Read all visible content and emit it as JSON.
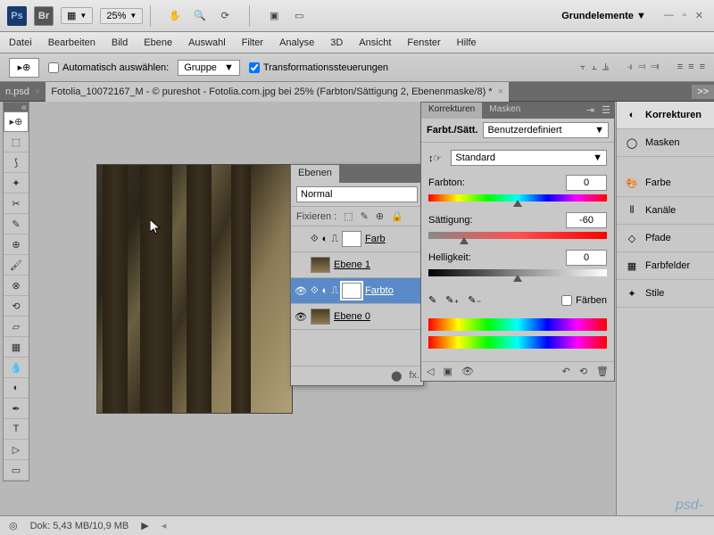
{
  "top": {
    "zoom": "25%",
    "workspace": "Grundelemente"
  },
  "menu": [
    "Datei",
    "Bearbeiten",
    "Bild",
    "Ebene",
    "Auswahl",
    "Filter",
    "Analyse",
    "3D",
    "Ansicht",
    "Fenster",
    "Hilfe"
  ],
  "options": {
    "auto_select": "Automatisch auswählen:",
    "group": "Gruppe",
    "transform": "Transformationssteuerungen"
  },
  "tabs": {
    "t1": "n.psd",
    "t2": "Fotolia_10072167_M - © pureshot - Fotolia.com.jpg bei 25% (Farbton/Sättigung 2, Ebenenmaske/8) *",
    "more": ">>"
  },
  "layers": {
    "title": "Ebenen",
    "blend": "Normal",
    "lock": "Fixieren :",
    "rows": [
      {
        "name": "Farb",
        "kind": "adj"
      },
      {
        "name": "Ebene 1",
        "kind": "img"
      },
      {
        "name": "Farbto",
        "kind": "adj"
      },
      {
        "name": "Ebene 0",
        "kind": "img"
      }
    ]
  },
  "adj": {
    "tab1": "Korrekturen",
    "tab2": "Masken",
    "title": "Farbt./Sätt.",
    "preset": "Benutzerdefiniert",
    "channel": "Standard",
    "hue_lbl": "Farbton:",
    "hue_val": "0",
    "sat_lbl": "Sättigung:",
    "sat_val": "-60",
    "light_lbl": "Helligkeit:",
    "light_val": "0",
    "colorize": "Färben"
  },
  "right": [
    "Korrekturen",
    "Masken",
    "Farbe",
    "Kanäle",
    "Pfade",
    "Farbfelder",
    "Stile"
  ],
  "status": {
    "doc": "Dok: 5,43 MB/10,9 MB"
  }
}
